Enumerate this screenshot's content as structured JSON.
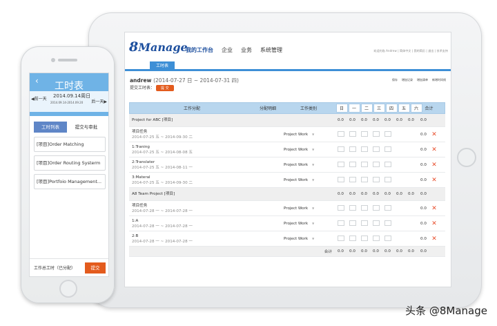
{
  "tablet": {
    "logo": {
      "prefix": "8",
      "name": "Manage"
    },
    "nav": [
      "我的工作台",
      "企业",
      "业务",
      "系统管理"
    ],
    "top_links": "欢迎光临 Andrew | 简体中文 | 我的简历 | 退出 | 技术支持",
    "tab": "工时表",
    "user": {
      "name": "andrew",
      "range": "(2014-07-27 日 ~ 2014-07-31 四)"
    },
    "submit_label": "提交工时表：",
    "submit_badge": "提 交",
    "actions": [
      "保存",
      "增加记录",
      "增加清单",
      "新增时间线"
    ],
    "columns": {
      "task": "工作分配",
      "detail": "分配明细",
      "type": "工作类别",
      "days": [
        "日",
        "一",
        "二",
        "三",
        "四",
        "五",
        "六"
      ],
      "sum": "合计"
    },
    "groups": [
      {
        "title": "Project for ABC [项目]",
        "totals": [
          "0.0",
          "0.0",
          "0.0",
          "0.0",
          "0.0",
          "0.0",
          "0.0",
          "0.0"
        ],
        "rows": [
          {
            "name": "项目任务",
            "dates": "2014-07-25 五 ~ 2014-09-30 二",
            "type": "Project Work",
            "sum": "0.0"
          },
          {
            "name": "1:Traning",
            "dates": "2014-07-25 五 ~ 2014-08-08 五",
            "type": "Project Work",
            "sum": "0.0"
          },
          {
            "name": "2:Translater",
            "dates": "2014-07-25 五 ~ 2014-08-11 一",
            "type": "Project Work",
            "sum": "0.0"
          },
          {
            "name": "3:Materal",
            "dates": "2014-07-25 五 ~ 2014-09-30 二",
            "type": "Project Work",
            "sum": "0.0"
          }
        ]
      },
      {
        "title": "A8 Team Project [项目]",
        "totals": [
          "0.0",
          "0.0",
          "0.0",
          "0.0",
          "0.0",
          "0.0",
          "0.0",
          "0.0"
        ],
        "rows": [
          {
            "name": "项目任务",
            "dates": "2014-07-28 一 ~ 2014-07-28 一",
            "type": "Project Work",
            "sum": "0.0"
          },
          {
            "name": "1:A",
            "dates": "2014-07-28 一 ~ 2014-07-28 一",
            "type": "Project Work",
            "sum": "0.0"
          },
          {
            "name": "2:B",
            "dates": "2014-07-28 一 ~ 2014-07-28 一",
            "type": "Project Work",
            "sum": "0.0"
          }
        ]
      }
    ],
    "total_row": {
      "label": "合计",
      "values": [
        "0.0",
        "0.0",
        "0.0",
        "0.0",
        "0.0",
        "0.0",
        "0.0",
        "0.0"
      ]
    }
  },
  "phone": {
    "title": "工时表",
    "prev": "◀前一天",
    "next": "后一天▶",
    "date": "2014.09.14周日",
    "range": "2014.09.14-2014.09.20",
    "tabs": [
      "工时列表",
      "提交与审批"
    ],
    "items": [
      "[项目]Order Matching",
      "[项目]Order Routing Systerm",
      "[项目]Portfoio Management..."
    ],
    "footer_label": "工作总工时（已分配）",
    "submit": "提交"
  },
  "watermark": "头条 @8Manage"
}
